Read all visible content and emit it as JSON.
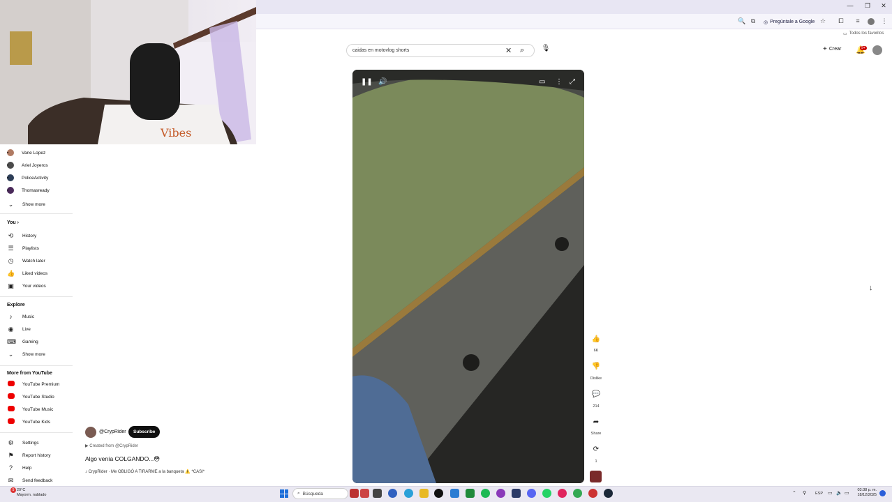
{
  "browser": {
    "ask_google": "Pregúntale a Google",
    "favorites_all": "Todos los favoritos"
  },
  "youtube": {
    "search_value": "caidas en motovlog shorts",
    "create_label": "Crear",
    "notif_badge": "9+"
  },
  "sidebar": {
    "subscriptions": [
      {
        "name": "Vane Lopez",
        "color": "#b07a62"
      },
      {
        "name": "Ariel Joyeros",
        "color": "#4b4b4b"
      },
      {
        "name": "PoliceActivity",
        "color": "#2d3e57"
      },
      {
        "name": "Thomasready",
        "color": "#4a2a5a"
      }
    ],
    "show_more": "Show more",
    "you_title": "You",
    "you_items": [
      {
        "label": "History",
        "icon": "history-icon",
        "glyph": "⟲"
      },
      {
        "label": "Playlists",
        "icon": "playlist-icon",
        "glyph": "☰"
      },
      {
        "label": "Watch later",
        "icon": "clock-icon",
        "glyph": "◷"
      },
      {
        "label": "Liked videos",
        "icon": "thumb-up-icon",
        "glyph": "👍"
      },
      {
        "label": "Your videos",
        "icon": "video-icon",
        "glyph": "▣"
      }
    ],
    "explore_title": "Explore",
    "explore_items": [
      {
        "label": "Music",
        "icon": "music-icon",
        "glyph": "♪"
      },
      {
        "label": "Live",
        "icon": "live-icon",
        "glyph": "◉"
      },
      {
        "label": "Gaming",
        "icon": "gaming-icon",
        "glyph": "⌨"
      }
    ],
    "explore_show_more": "Show more",
    "more_title": "More from YouTube",
    "more_items": [
      {
        "label": "YouTube Premium"
      },
      {
        "label": "YouTube Studio"
      },
      {
        "label": "YouTube Music"
      },
      {
        "label": "YouTube Kids"
      }
    ],
    "bottom_items": [
      {
        "label": "Settings",
        "icon": "gear-icon",
        "glyph": "⚙"
      },
      {
        "label": "Report history",
        "icon": "flag-icon",
        "glyph": "⚑"
      },
      {
        "label": "Help",
        "icon": "help-icon",
        "glyph": "?"
      },
      {
        "label": "Send feedback",
        "icon": "feedback-icon",
        "glyph": "✉"
      }
    ]
  },
  "short": {
    "channel": "@CrypRider",
    "subscribe": "Subscribe",
    "created_from": "Created from @CrypRider",
    "title": "Algo venía COLGANDO...😳",
    "music": "CrypRider · Me OBLIGÓ A TIRARME a la banqueta ⚠️ *CASI*",
    "likes": "6K",
    "dislike": "Dislike",
    "comments": "214",
    "share": "Share",
    "remix": "1"
  },
  "taskbar": {
    "search": "Búsqueda",
    "weather_temp": "20°C",
    "weather_desc": "Mayorm. nublado",
    "weather_badge": "5",
    "time": "03:38 p. m.",
    "date": "18/12/2025",
    "lang": "ESP"
  }
}
